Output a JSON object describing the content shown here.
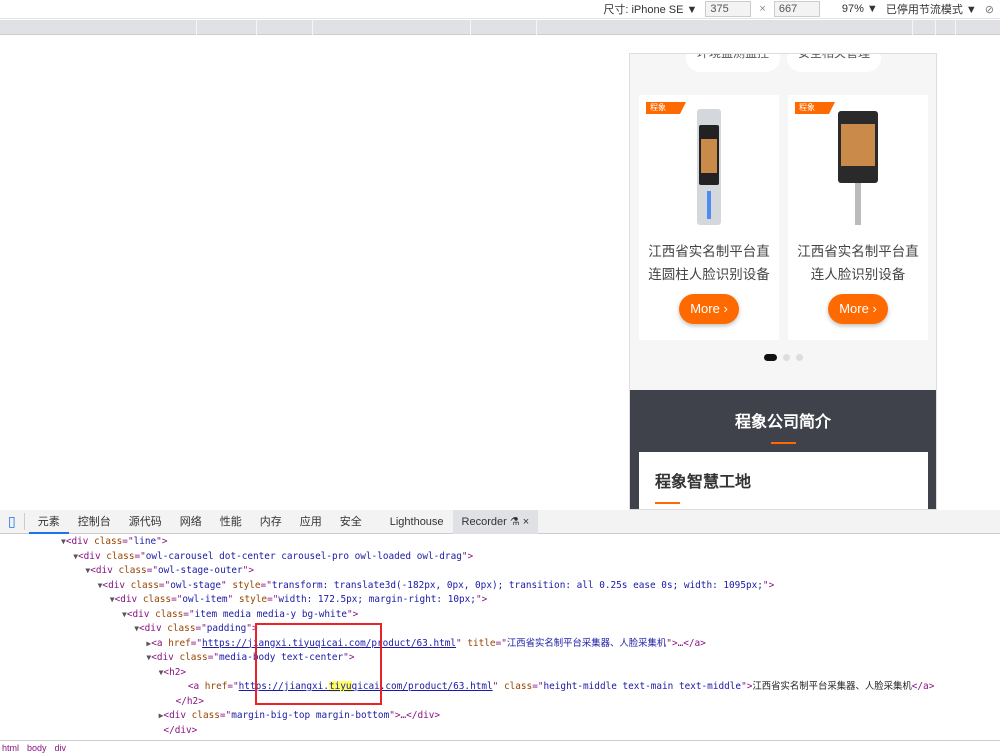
{
  "toolbar": {
    "size_label": "尺寸: iPhone SE ▼",
    "width": "375",
    "times": "×",
    "height": "667",
    "zoom": "97% ▼",
    "throttle": "已停用节流模式 ▼",
    "rotate_icon": "rotate-icon"
  },
  "page": {
    "tags": [
      "环境监测监控",
      "安全相关管理"
    ],
    "products": [
      {
        "badge": "程象",
        "title_line1": "江西省实名制平台直",
        "title_line2": "连圆柱人脸识别设备",
        "more": "More ›"
      },
      {
        "badge": "程象",
        "title_line1": "江西省实名制平台直",
        "title_line2": "连人脸识别设备",
        "more": "More ›"
      }
    ],
    "carousel_active": 1,
    "carousel_total": 3,
    "about_title": "程象公司简介",
    "about_box_title": "程象智慧工地",
    "accent": "#ff6a00"
  },
  "devtools": {
    "tabs": [
      "元素",
      "控制台",
      "源代码",
      "网络",
      "性能",
      "内存",
      "应用",
      "安全",
      "Lighthouse",
      "Recorder"
    ],
    "recorder_close": "×",
    "code": [
      {
        "i": 5,
        "t": "▼",
        "tag": "div",
        "attrs": [
          [
            "class",
            "line"
          ]
        ],
        "end": ">"
      },
      {
        "i": 6,
        "t": "▼",
        "tag": "div",
        "attrs": [
          [
            "class",
            "owl-carousel dot-center carousel-pro owl-loaded owl-drag"
          ]
        ],
        "end": ">"
      },
      {
        "i": 7,
        "t": "▼",
        "tag": "div",
        "attrs": [
          [
            "class",
            "owl-stage-outer"
          ]
        ],
        "end": ">"
      },
      {
        "i": 8,
        "t": "▼",
        "tag": "div",
        "attrs": [
          [
            "class",
            "owl-stage"
          ],
          [
            "style",
            "transform: translate3d(-182px, 0px, 0px); transition: all 0.25s ease 0s; width: 1095px;"
          ]
        ],
        "end": ">"
      },
      {
        "i": 9,
        "t": "▼",
        "tag": "div",
        "attrs": [
          [
            "class",
            "owl-item"
          ],
          [
            "style",
            "width: 172.5px; margin-right: 10px;"
          ]
        ],
        "end": ">"
      },
      {
        "i": 10,
        "t": "▼",
        "tag": "div",
        "attrs": [
          [
            "class",
            "item media media-y bg-white"
          ]
        ],
        "end": ">"
      },
      {
        "i": 11,
        "t": "▼",
        "tag": "div",
        "attrs": [
          [
            "class",
            "padding"
          ]
        ],
        "end": ">"
      },
      {
        "i": 12,
        "t": "▶",
        "tag": "a",
        "attrs": [
          [
            "href",
            "https://jiangxi.tiyuqicai.com/product/63.html"
          ],
          [
            "title",
            "江西省实名制平台采集器、人脸采集机"
          ]
        ],
        "end": ">…</a>"
      },
      {
        "i": 12,
        "t": "▼",
        "tag": "div",
        "attrs": [
          [
            "class",
            "media-body text-center"
          ]
        ],
        "end": ">"
      },
      {
        "i": 13,
        "t": "▼",
        "tag": "h2",
        "attrs": [],
        "end": ">"
      },
      {
        "i": 15,
        "t": "",
        "tag": "a",
        "attrs": [
          [
            "href",
            "https://jiangxi.tiyuqicai.com/product/63.html"
          ],
          [
            "class",
            "height-middle text-main text-middle"
          ]
        ],
        "end": ">",
        "text": "江西省实名制平台采集器、人脸采集机",
        "close": "</a>"
      },
      {
        "i": 14,
        "t": "",
        "close_only": "</h2>"
      },
      {
        "i": 13,
        "t": "▶",
        "tag": "div",
        "attrs": [
          [
            "class",
            "margin-big-top margin-bottom"
          ]
        ],
        "end": ">…</div>"
      },
      {
        "i": 13,
        "t": "",
        "close_only": "</div>"
      }
    ],
    "breadcrumbs": [
      "html",
      "body",
      "div"
    ]
  }
}
